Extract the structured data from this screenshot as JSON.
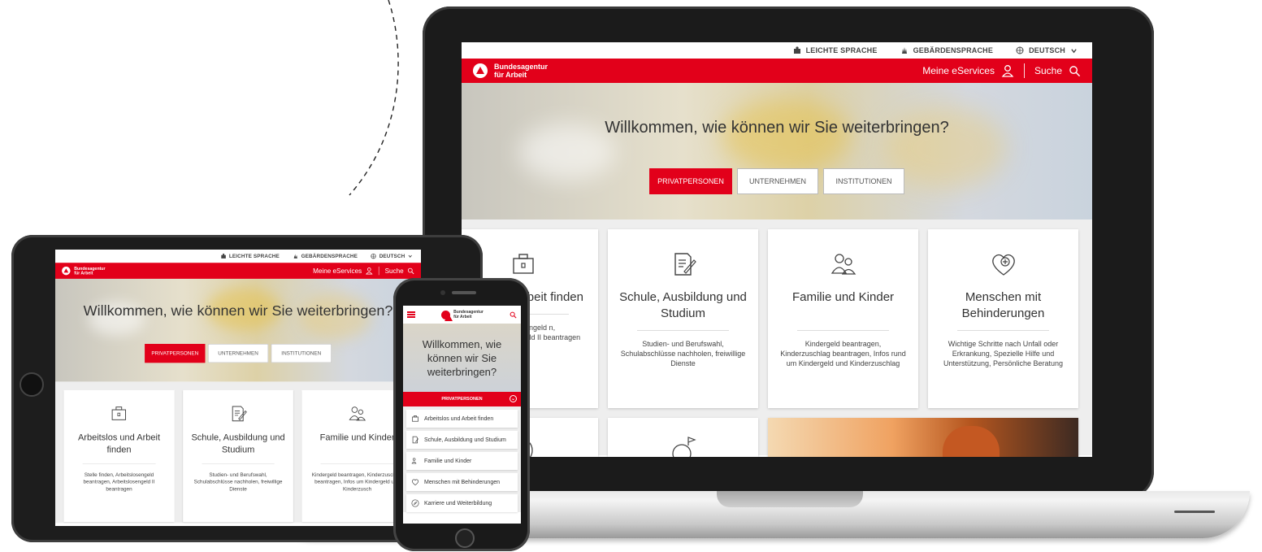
{
  "utility": {
    "easy_language": "LEICHTE SPRACHE",
    "sign_language": "GEBÄRDENSPRACHE",
    "language": "DEUTSCH"
  },
  "brand": {
    "line1": "Bundesagentur",
    "line2": "für Arbeit",
    "color": "#e2001a"
  },
  "nav": {
    "eservices": "Meine eServices",
    "search": "Suche"
  },
  "hero": {
    "title": "Willkommen, wie können wir Sie weiterbringen?",
    "title_phone": "Willkommen, wie können wir Sie weiterbringen?"
  },
  "tabs": [
    "PRIVATPERSONEN",
    "UNTERNEHMEN",
    "INSTITUTIONEN"
  ],
  "laptop_cards": [
    {
      "title": "los und Arbeit finden",
      "icon": "briefcase-icon",
      "desc": "en, Arbeitslosengeld n, Arbeitslosengeld II beantragen"
    },
    {
      "title": "Schule, Ausbildung und Studium",
      "icon": "document-pen-icon",
      "desc": "Studien- und Berufswahl, Schulabschlüsse nachholen, freiwillige Dienste"
    },
    {
      "title": "Familie und Kinder",
      "icon": "family-icon",
      "desc": "Kindergeld beantragen, Kinderzuschlag beantragen, Infos rund um Kindergeld und Kinderzuschlag"
    },
    {
      "title": "Menschen mit Behinderungen",
      "icon": "heart-plus-icon",
      "desc": "Wichtige Schritte nach Unfall oder Erkrankung, Spezielle Hilfe und Unterstützung, Persönliche Beratung"
    }
  ],
  "tablet_cards": [
    {
      "title": "Arbeitslos und Arbeit finden",
      "icon": "briefcase-icon",
      "desc": "Stelle finden, Arbeitslosengeld beantragen, Arbeitslosengeld II beantragen"
    },
    {
      "title": "Schule, Ausbildung und Studium",
      "icon": "document-pen-icon",
      "desc": "Studien- und Berufswahl, Schulabschlüsse nachholen, freiwillige Dienste"
    },
    {
      "title": "Familie und Kinder",
      "icon": "family-icon",
      "desc": "Kindergeld beantragen, Kinderzuschlag beantragen, Infos um Kindergeld und Kinderzusch"
    }
  ],
  "phone": {
    "selected_tab": "PRIVATPERSONEN",
    "items": [
      {
        "label": "Arbeitslos und Arbeit finden",
        "icon": "briefcase-icon"
      },
      {
        "label": "Schule, Ausbildung und Studium",
        "icon": "document-pen-icon"
      },
      {
        "label": "Familie und Kinder",
        "icon": "family-icon"
      },
      {
        "label": "Menschen mit Behinderungen",
        "icon": "heart-icon"
      },
      {
        "label": "Karriere und Weiterbildung",
        "icon": "compass-icon"
      }
    ]
  }
}
